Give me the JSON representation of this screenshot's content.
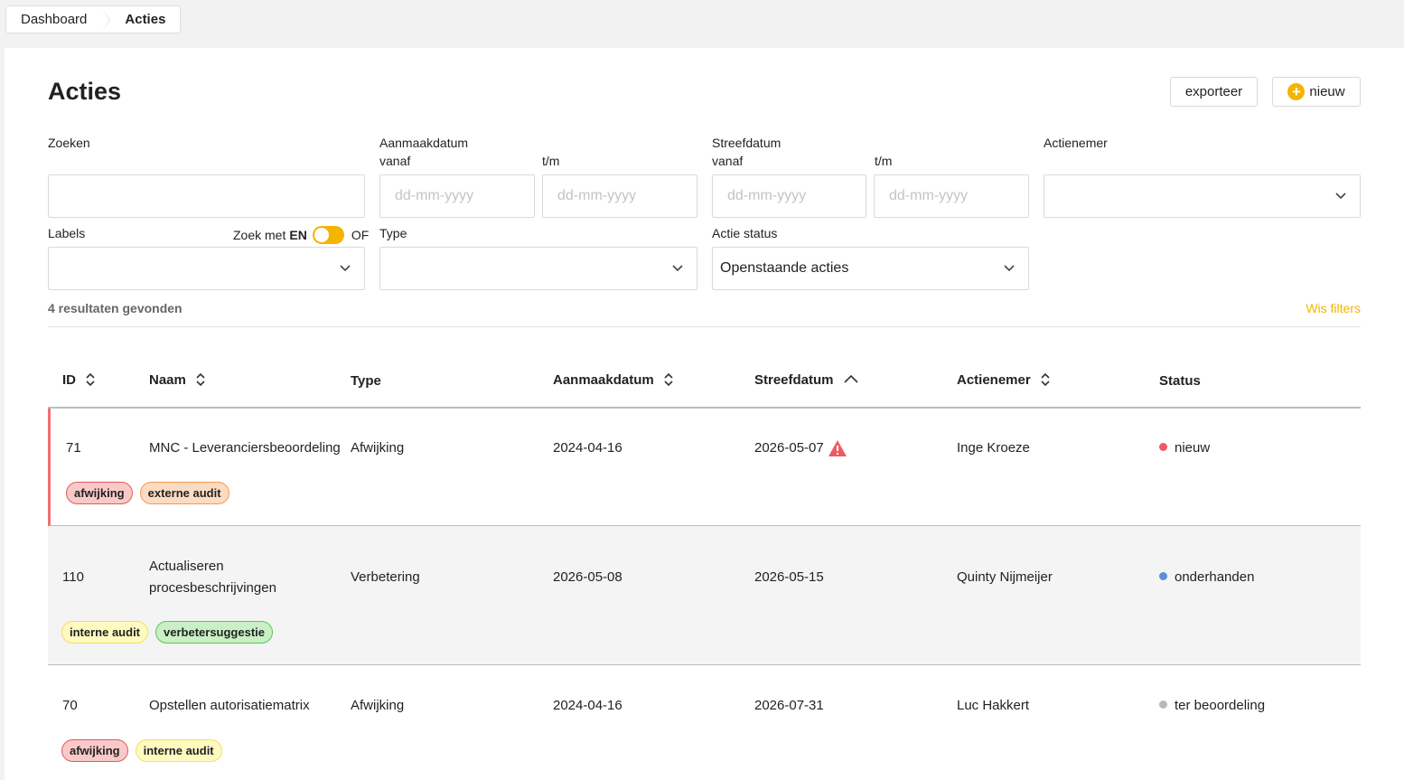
{
  "breadcrumb": {
    "items": [
      "Dashboard",
      "Acties"
    ]
  },
  "page": {
    "title": "Acties"
  },
  "buttons": {
    "export": "exporteer",
    "new": "nieuw"
  },
  "filters": {
    "search_label": "Zoeken",
    "created_label": "Aanmaakdatum",
    "target_label": "Streefdatum",
    "from_label": "vanaf",
    "to_label": "t/m",
    "date_placeholder": "dd-mm-yyyy",
    "assignee_label": "Actienemer",
    "labels_label": "Labels",
    "search_with": "Zoek met",
    "and_label": "EN",
    "or_label": "OF",
    "type_label": "Type",
    "status_label": "Actie status",
    "status_value": "Openstaande acties"
  },
  "results": {
    "count_text": "4 resultaten gevonden",
    "clear_filters": "Wis filters"
  },
  "table": {
    "columns": [
      "ID",
      "Naam",
      "Type",
      "Aanmaakdatum",
      "Streefdatum",
      "Actienemer",
      "Status"
    ],
    "rows": [
      {
        "id": "71",
        "name": "MNC - Leveranciersbeoordeling",
        "type": "Afwijking",
        "created": "2024-04-16",
        "target": "2026-05-07",
        "assignee": "Inge Kroeze",
        "status": "nieuw",
        "status_color": "#ef5b63",
        "tags": [
          "afwijking",
          "externe audit"
        ],
        "overdue_warning": true
      },
      {
        "id": "110",
        "name_line1": "Actualiseren",
        "name_line2": "procesbeschrijvingen",
        "type": "Verbetering",
        "created": "2026-05-08",
        "target": "2026-05-15",
        "assignee": "Quinty Nijmeijer",
        "status": "onderhanden",
        "status_color": "#5b8fdc",
        "tags": [
          "interne audit",
          "verbetersuggestie"
        ]
      },
      {
        "id": "70",
        "name": "Opstellen autorisatiematrix",
        "type": "Afwijking",
        "created": "2024-04-16",
        "target": "2026-07-31",
        "assignee": "Luc Hakkert",
        "status": "ter beoordeling",
        "status_color": "#b8b8b8",
        "tags": [
          "afwijking",
          "interne audit"
        ]
      }
    ]
  },
  "colors": {
    "accent": "#f4b400",
    "flag": "#ef6f72"
  },
  "icons": {
    "plus": "plus-circle-icon",
    "chevron": "chevron-down-icon",
    "sort": "sort-icon",
    "sort_asc": "sort-ascending-icon",
    "warning": "warning-triangle-icon"
  }
}
